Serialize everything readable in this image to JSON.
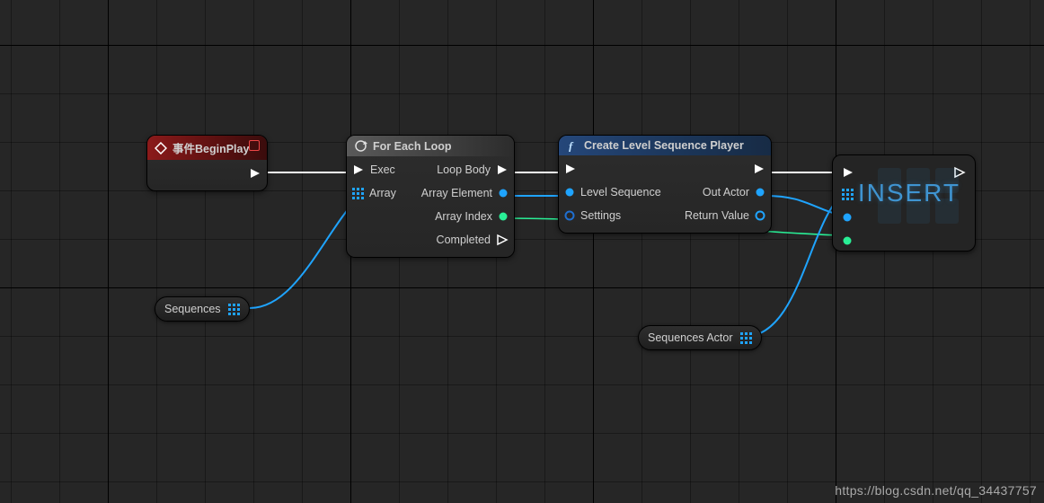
{
  "watermark": "https://blog.csdn.net/qq_34437757",
  "colors": {
    "exec": "#ffffff",
    "object": "#1fa4ff",
    "blue": "#1fa4ff",
    "green": "#29ef96",
    "array_grid": "#1fa4ff"
  },
  "nodes": {
    "beginplay": {
      "title": "事件BeginPlay",
      "outputs": {
        "exec": ""
      }
    },
    "foreach": {
      "title": "For Each Loop",
      "inputs": {
        "exec": "Exec",
        "array": "Array"
      },
      "outputs": {
        "loopbody": "Loop Body",
        "element": "Array Element",
        "index": "Array Index",
        "completed": "Completed"
      }
    },
    "createplayer": {
      "title": "Create Level Sequence Player",
      "inputs": {
        "exec": "",
        "levelseq": "Level Sequence",
        "settings": "Settings"
      },
      "outputs": {
        "exec": "",
        "outactor": "Out Actor",
        "returnvalue": "Return Value"
      }
    },
    "insert": {
      "big": "INSERT",
      "inputs": {
        "exec": "",
        "array": "",
        "obj": "",
        "index": ""
      },
      "outputs": {
        "exec": ""
      }
    }
  },
  "vars": {
    "sequences": "Sequences",
    "sequences_actor": "Sequences Actor"
  }
}
